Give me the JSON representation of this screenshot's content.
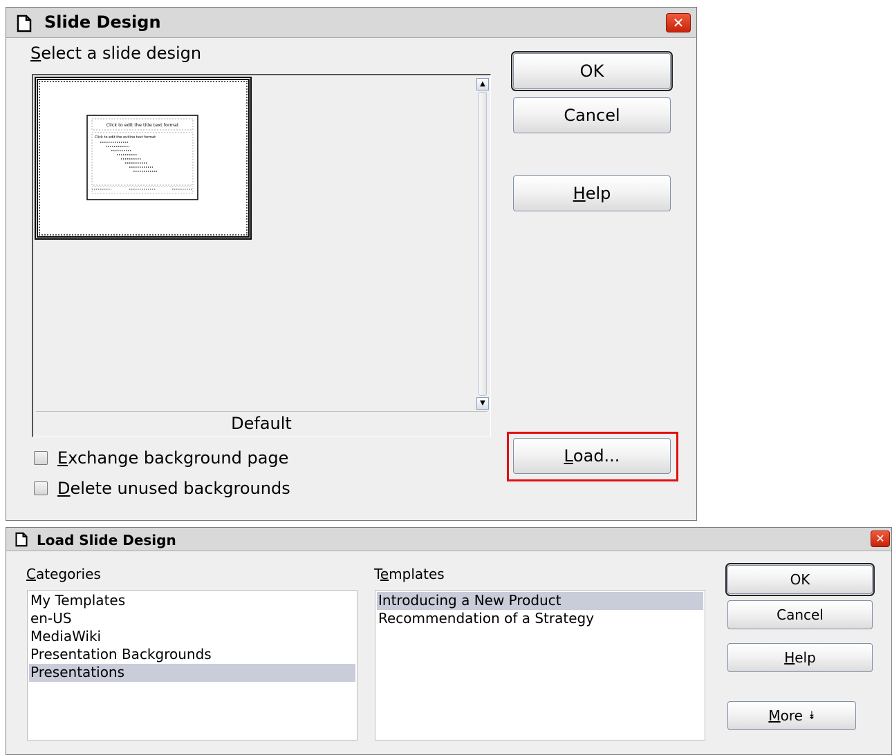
{
  "slide_design": {
    "title": "Slide Design",
    "select_label_first": "S",
    "select_label_rest": "elect a slide design",
    "design_caption": "Default",
    "preview_title_text": "Click to edit the title text format",
    "preview_outline_text": "Click to edit the outline text format",
    "checkboxes": [
      {
        "first": "E",
        "rest": "xchange background page",
        "checked": false
      },
      {
        "first": "D",
        "rest": "elete unused backgrounds",
        "checked": false
      }
    ],
    "buttons": {
      "ok": "OK",
      "cancel": "Cancel",
      "help_first": "H",
      "help_rest": "elp",
      "load_first": "L",
      "load_rest": "oad..."
    }
  },
  "load_slide_design": {
    "title": "Load Slide Design",
    "categories_first": "C",
    "categories_rest": "ategories",
    "templates_pre": "T",
    "templates_u": "e",
    "templates_rest": "mplates",
    "categories": [
      {
        "label": "My Templates",
        "selected": false
      },
      {
        "label": "en-US",
        "selected": false
      },
      {
        "label": "MediaWiki",
        "selected": false
      },
      {
        "label": "Presentation Backgrounds",
        "selected": false
      },
      {
        "label": "Presentations",
        "selected": true
      }
    ],
    "templates": [
      {
        "label": "Introducing a New Product",
        "selected": true
      },
      {
        "label": "Recommendation of a Strategy",
        "selected": false
      }
    ],
    "buttons": {
      "ok": "OK",
      "cancel": "Cancel",
      "help_first": "H",
      "help_rest": "elp",
      "more_first": "M",
      "more_rest": "ore",
      "more_glyph": "⯯"
    }
  },
  "colors": {
    "highlight_border": "#e01010",
    "selection": "#c9ccd9",
    "close_button": "#d9381e"
  }
}
